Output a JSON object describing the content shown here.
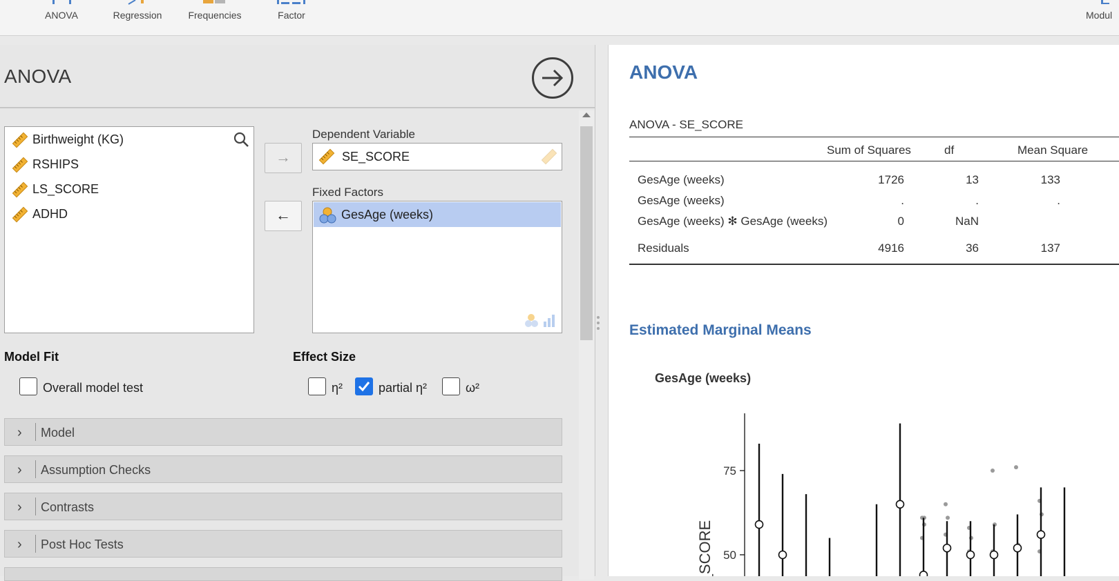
{
  "ribbon": {
    "items": [
      {
        "label": "ANOVA",
        "icon": "anova-icon"
      },
      {
        "label": "Regression",
        "icon": "regression-icon"
      },
      {
        "label": "Frequencies",
        "icon": "frequencies-icon"
      },
      {
        "label": "Factor",
        "icon": "factor-icon"
      }
    ],
    "modules_label": "Modul"
  },
  "options": {
    "title": "ANOVA",
    "variables": [
      "Birthweight (KG)",
      "RSHIPS",
      "LS_SCORE",
      "ADHD"
    ],
    "dependent_label": "Dependent Variable",
    "dependent_value": "SE_SCORE",
    "fixed_label": "Fixed Factors",
    "fixed_values": [
      "GesAge (weeks)"
    ],
    "arrow_right": "→",
    "arrow_left": "←",
    "model_fit": {
      "title": "Model Fit",
      "overall_label": "Overall model test",
      "overall_checked": false
    },
    "effect_size": {
      "title": "Effect Size",
      "eta_label": "η²",
      "eta_checked": false,
      "partial_eta_label": "partial η²",
      "partial_eta_checked": true,
      "omega_label": "ω²",
      "omega_checked": false
    },
    "sections": [
      "Model",
      "Assumption Checks",
      "Contrasts",
      "Post Hoc Tests"
    ]
  },
  "results": {
    "title": "ANOVA",
    "table_caption": "ANOVA - SE_SCORE",
    "columns": [
      "Sum of Squares",
      "df",
      "Mean Square"
    ],
    "rows": [
      {
        "term": "GesAge (weeks)",
        "ss": "1726",
        "df": "13",
        "ms": "133"
      },
      {
        "term": "GesAge (weeks)",
        "ss": ".",
        "df": ".",
        "ms": "."
      },
      {
        "term": "GesAge (weeks) ✻ GesAge (weeks)",
        "ss": "0",
        "df": "NaN",
        "ms": ""
      },
      {
        "term": "Residuals",
        "ss": "4916",
        "df": "36",
        "ms": "137"
      }
    ],
    "emm_title": "Estimated Marginal Means",
    "plot_title": "GesAge (weeks)"
  },
  "chart_data": {
    "type": "scatter",
    "title": "GesAge (weeks)",
    "ylabel": "SE_SCORE",
    "yticks": [
      50,
      75
    ],
    "ylim": [
      44,
      92
    ],
    "groups": [
      {
        "mean": 59,
        "lo": null,
        "hi": 83
      },
      {
        "mean": 50,
        "lo": null,
        "hi": 74
      },
      {
        "mean": null,
        "lo": null,
        "hi": 68
      },
      {
        "mean": null,
        "lo": null,
        "hi": 55
      },
      {
        "mean": null,
        "lo": null,
        "hi": null
      },
      {
        "mean": null,
        "lo": null,
        "hi": 65
      },
      {
        "mean": 65,
        "lo": null,
        "hi": 89
      },
      {
        "mean": 44,
        "lo": null,
        "hi": 61,
        "points": [
          61,
          59,
          55,
          61
        ]
      },
      {
        "mean": 52,
        "lo": null,
        "hi": 60,
        "points": [
          65,
          61,
          56
        ]
      },
      {
        "mean": 50,
        "lo": null,
        "hi": 60,
        "points": [
          58,
          55,
          51
        ]
      },
      {
        "mean": 50,
        "lo": null,
        "hi": 59,
        "points": [
          75,
          59,
          51
        ]
      },
      {
        "mean": 52,
        "lo": null,
        "hi": 62,
        "points": [
          76,
          53
        ]
      },
      {
        "mean": 56,
        "lo": null,
        "hi": 70,
        "points": [
          66,
          62,
          51
        ]
      },
      {
        "mean": null,
        "lo": null,
        "hi": 70
      }
    ],
    "grid": false
  }
}
